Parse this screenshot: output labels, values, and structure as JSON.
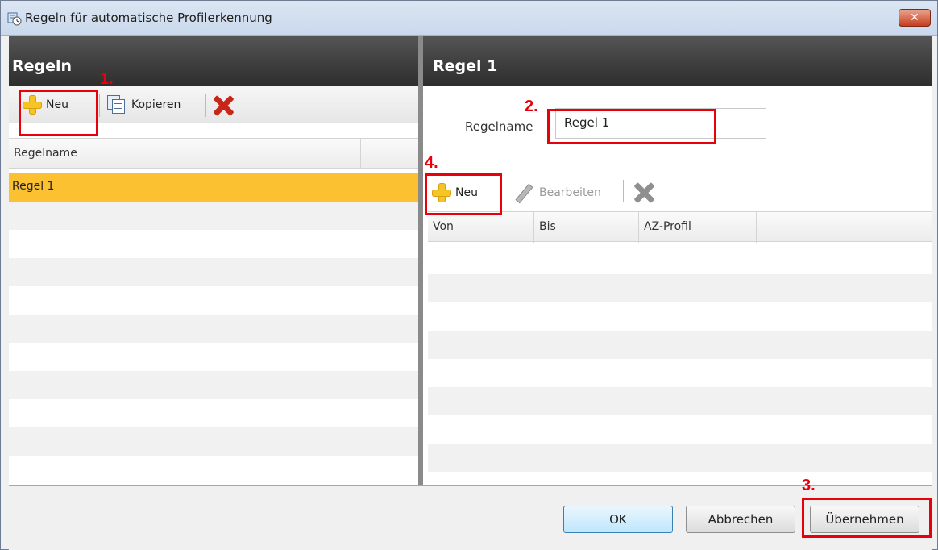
{
  "window": {
    "title": "Regeln für automatische Profilerkennung",
    "close_symbol": "✕"
  },
  "left_panel": {
    "header": "Regeln",
    "toolbar": {
      "new_label": "Neu",
      "copy_label": "Kopieren"
    },
    "grid": {
      "columns": [
        "Regelname"
      ],
      "rows": [
        "Regel 1"
      ]
    }
  },
  "right_panel": {
    "header": "Regel 1",
    "rule_name_label": "Regelname",
    "rule_name_value": "Regel 1",
    "toolbar": {
      "new_label": "Neu",
      "edit_label": "Bearbeiten"
    },
    "grid": {
      "columns": [
        "Von",
        "Bis",
        "AZ-Profil"
      ],
      "rows": []
    }
  },
  "buttons": {
    "ok": "OK",
    "cancel": "Abbrechen",
    "apply": "Übernehmen"
  },
  "annotations": {
    "step1": "1.",
    "step2": "2.",
    "step3": "3.",
    "step4": "4."
  },
  "colors": {
    "annotation": "#e8000b",
    "selected_row": "#fbc131",
    "header_bg": "#3e3e3e"
  }
}
